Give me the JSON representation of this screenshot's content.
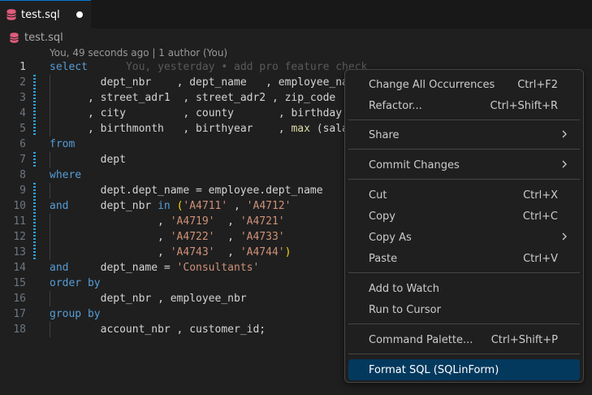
{
  "tab": {
    "label": "test.sql"
  },
  "breadcrumb": {
    "label": "test.sql"
  },
  "blame": {
    "text": "You, 49 seconds ago | 1 author (You)"
  },
  "ghost_text": "You, yesterday • add pro feature check",
  "line_numbers": [
    "1",
    "2",
    "3",
    "4",
    "5",
    "6",
    "7",
    "8",
    "9",
    "10",
    "11",
    "12",
    "13",
    "14",
    "15",
    "16",
    "17",
    "18"
  ],
  "code": {
    "l1_kw": "select",
    "l2_a": "dept_nbr",
    "l2_b": ", dept_name",
    "l2_c": ", employee_na",
    "l3_a": ", street_adr1",
    "l3_b": ", street_adr2",
    "l3_c": ", zip_code",
    "l4_a": ", city",
    "l4_b": ", county",
    "l4_c": ", birthday",
    "l5_a": ", birthmonth",
    "l5_b": ", birthyear",
    "l5_c": ", ",
    "l5_fn": "max",
    "l5_d": " (salary",
    "l6_kw": "from",
    "l7_a": "dept",
    "l8_kw": "where",
    "l9_a": "dept.dept_name = employee.dept_name",
    "l10_kw": "and",
    "l10_a": "dept_nbr ",
    "l10_in": "in",
    "l10_s1": "'A4711'",
    "l10_s2": "'A4712'",
    "l11_s1": "'A4719'",
    "l11_s2": "'A4721'",
    "l12_s1": "'A4722'",
    "l12_s2": "'A4733'",
    "l13_s1": "'A4743'",
    "l13_s2": "'A4744'",
    "l14_kw": "and",
    "l14_a": "dept_name = ",
    "l14_s": "'Consultants'",
    "l15_kw": "order by",
    "l16_a": "dept_nbr , employee_nbr",
    "l17_kw": "group by",
    "l18_a": "account_nbr , customer_id;"
  },
  "menu": {
    "change_all": {
      "label": "Change All Occurrences",
      "shortcut": "Ctrl+F2"
    },
    "refactor": {
      "label": "Refactor...",
      "shortcut": "Ctrl+Shift+R"
    },
    "share": {
      "label": "Share"
    },
    "commit": {
      "label": "Commit Changes"
    },
    "cut": {
      "label": "Cut",
      "shortcut": "Ctrl+X"
    },
    "copy": {
      "label": "Copy",
      "shortcut": "Ctrl+C"
    },
    "copy_as": {
      "label": "Copy As"
    },
    "paste": {
      "label": "Paste",
      "shortcut": "Ctrl+V"
    },
    "add_watch": {
      "label": "Add to Watch"
    },
    "run_cursor": {
      "label": "Run to Cursor"
    },
    "palette": {
      "label": "Command Palette...",
      "shortcut": "Ctrl+Shift+P"
    },
    "format_sql": {
      "label": "Format SQL (SQLinForm)"
    }
  },
  "colors": {
    "accent": "#0078d4",
    "keyword": "#569cd6",
    "string": "#ce9178",
    "function": "#dcdcaa",
    "db_icon": "#e05c7a"
  }
}
